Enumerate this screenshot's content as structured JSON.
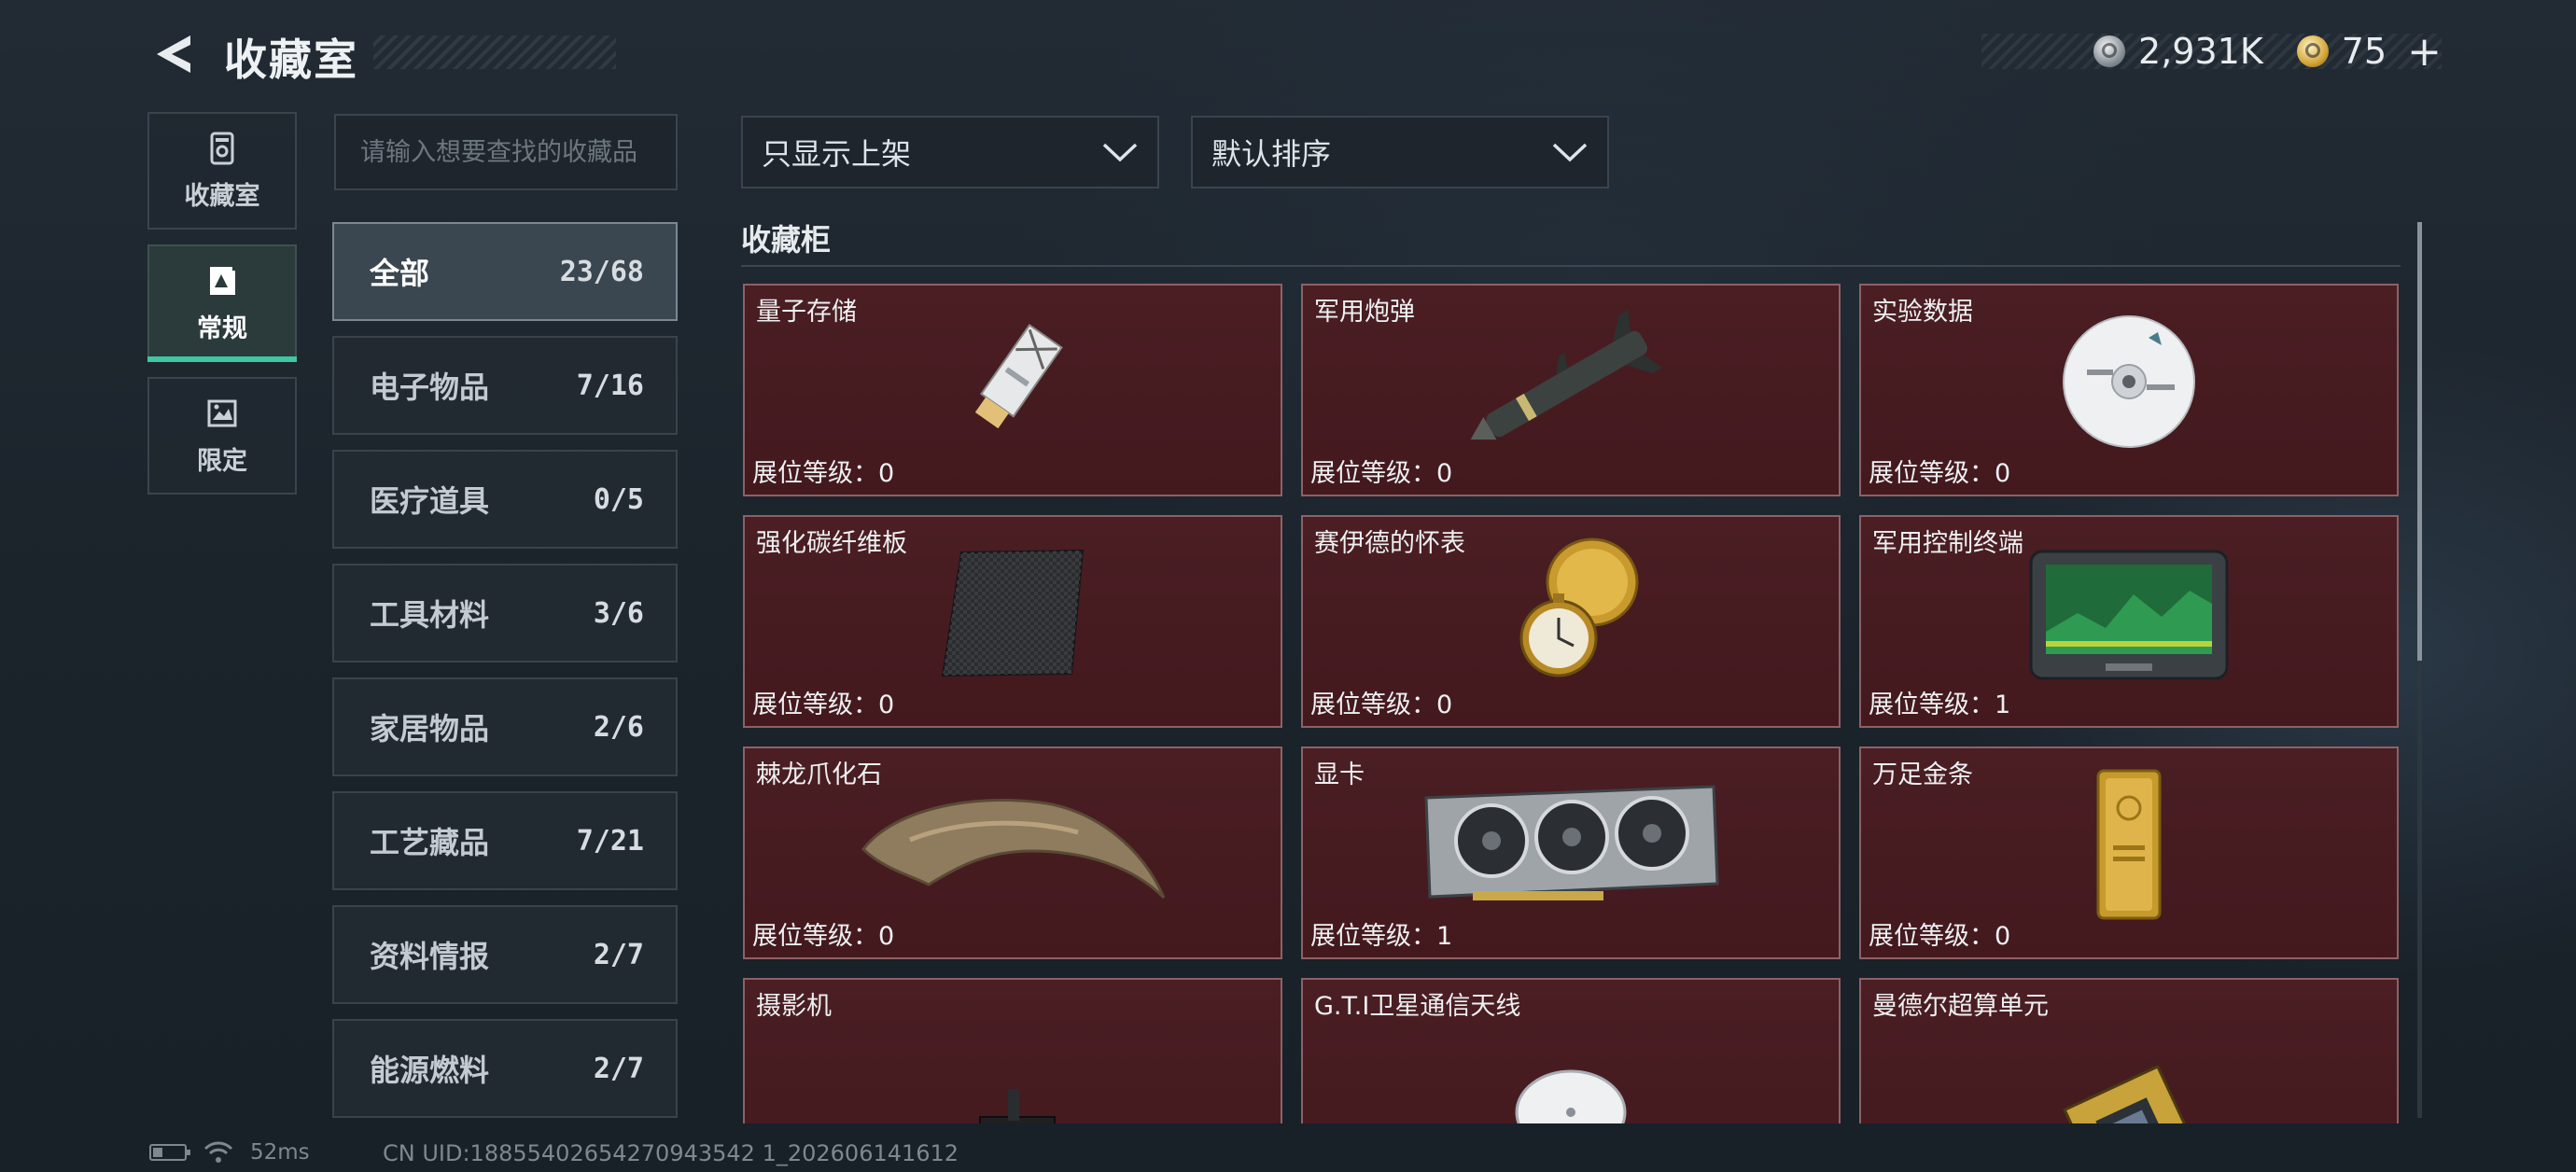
{
  "header": {
    "title": "收藏室",
    "currency_silver": "2,931K",
    "currency_gold": "75",
    "currency_gold_plus": "+"
  },
  "nav": [
    {
      "label": "收藏室",
      "icon": "collection-room-icon",
      "active": false
    },
    {
      "label": "常规",
      "icon": "regular-icon",
      "active": true
    },
    {
      "label": "限定",
      "icon": "limited-icon",
      "active": false
    }
  ],
  "search": {
    "placeholder": "请输入想要查找的收藏品",
    "value": ""
  },
  "categories": [
    {
      "label": "全部",
      "count": "23/68",
      "active": true
    },
    {
      "label": "电子物品",
      "count": "7/16"
    },
    {
      "label": "医疗道具",
      "count": "0/5"
    },
    {
      "label": "工具材料",
      "count": "3/6"
    },
    {
      "label": "家居物品",
      "count": "2/6"
    },
    {
      "label": "工艺藏品",
      "count": "7/21"
    },
    {
      "label": "资料情报",
      "count": "2/7"
    },
    {
      "label": "能源燃料",
      "count": "2/7"
    }
  ],
  "filters": {
    "shelf": "只显示上架",
    "sort": "默认排序"
  },
  "section_title": "收藏柜",
  "items": [
    {
      "name": "量子存储",
      "level": "展位等级：0",
      "icon": "quantum-storage-usb-icon"
    },
    {
      "name": "军用炮弹",
      "level": "展位等级：0",
      "icon": "military-shell-icon"
    },
    {
      "name": "实验数据",
      "level": "展位等级：0",
      "icon": "data-disc-icon"
    },
    {
      "name": "强化碳纤维板",
      "level": "展位等级：0",
      "icon": "carbon-fiber-plate-icon"
    },
    {
      "name": "赛伊德的怀表",
      "level": "展位等级：0",
      "icon": "pocket-watch-icon"
    },
    {
      "name": "军用控制终端",
      "level": "展位等级：1",
      "icon": "control-terminal-icon"
    },
    {
      "name": "棘龙爪化石",
      "level": "展位等级：0",
      "icon": "claw-fossil-icon"
    },
    {
      "name": "显卡",
      "level": "展位等级：1",
      "icon": "graphics-card-icon"
    },
    {
      "name": "万足金条",
      "level": "展位等级：0",
      "icon": "gold-bar-icon"
    },
    {
      "name": "摄影机",
      "level": "",
      "icon": "camera-icon"
    },
    {
      "name": "G.T.I卫星通信天线",
      "level": "",
      "icon": "satellite-antenna-icon"
    },
    {
      "name": "曼德尔超算单元",
      "level": "",
      "icon": "supercomputer-unit-icon"
    }
  ],
  "status": {
    "ping": "52ms",
    "uid": "CN UID:18855402654270943542 1_202606141612"
  }
}
